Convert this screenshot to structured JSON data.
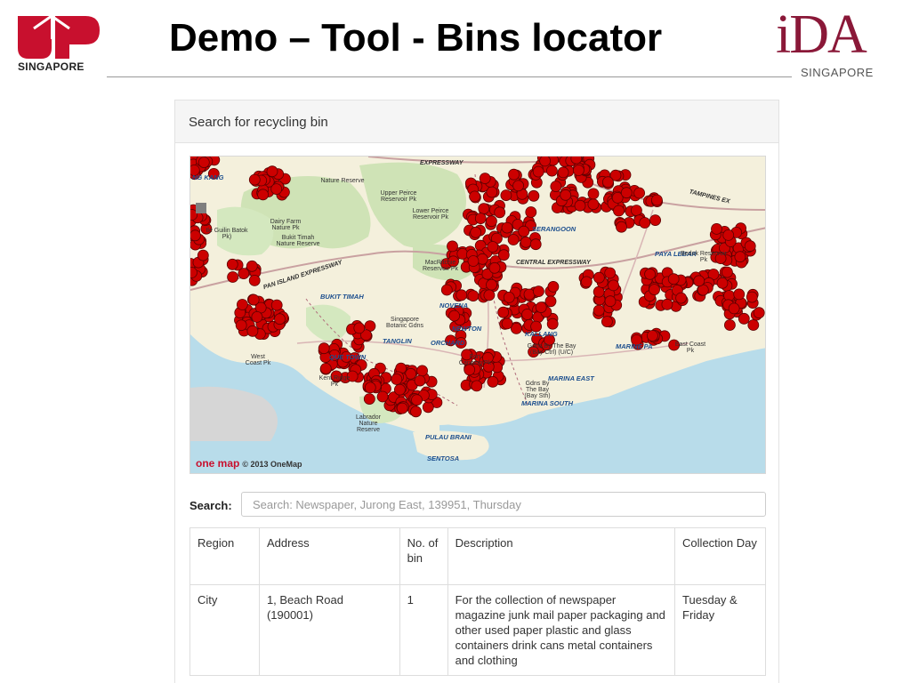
{
  "slide": {
    "title": "Demo – Tool - Bins locator",
    "left_logo_text": "SINGAPORE",
    "right_logo_text": "iDA",
    "right_logo_sub": "SINGAPORE"
  },
  "panel": {
    "heading": "Search for recycling bin"
  },
  "map": {
    "credit": "© 2013 OneMap",
    "credit_logo": "one map",
    "marker_color": "#cc0000",
    "labels": {
      "jurong_kang": "NG KANG",
      "nature_reserve": "Nature Reserve",
      "upper_peirce": "Upper Peirce Reservoir Pk",
      "lower_peirce": "Lower Peirce Reservoir Pk",
      "dairy_farm": "Dairy Farm Nature Pk",
      "bukit_timah_reserve": "Bukit Timah Nature Reserve",
      "guilin": "tle Guilin Batok Pk)",
      "serangoon": "SERANGOON",
      "paya_lebar": "PAYA LEBAR",
      "bedok": "Bedok Reservoir Pk",
      "macritchie": "MacRitchie Reservoir Pk",
      "central_expressway": "CENTRAL EXPRESSWAY",
      "pan_island": "PAN ISLAND EXPRESSWAY",
      "bukit_timah": "BUKIT TIMAH",
      "novena": "NOVENA",
      "singapore_botanic": "Singapore Botanic Gdns",
      "tanglin": "TANGLIN",
      "newton": "NEWTON",
      "orchard": "ORCHARD",
      "kallang": "KALLANG",
      "marine_parade": "MARINE PA",
      "east_coast": "East Coast Pk",
      "west_coast": "West Coast Pk",
      "queenstown": "QUE    TOWN",
      "kent_ridge": "Kent Ridge Pk",
      "fort_canning": "Fort Canning Pk",
      "gdns_bay_ctrl": "Gdns By The Bay (Bay Ctrl) (U/C)",
      "marina_east": "MARINA EAST",
      "gdns_bay_sth": "Gdns By The Bay (Bay Sth)",
      "marina_south": "MARINA SOUTH",
      "labrador": "Labrador Nature Reserve",
      "pulau_brani": "PULAU BRANI",
      "sentosa": "SENTOSA",
      "tampines_exp": "TAMPINES EX",
      "expressway_top": "EXPRESSWAY"
    }
  },
  "search": {
    "label": "Search:",
    "placeholder": "Search: Newspaper, Jurong East, 139951, Thursday"
  },
  "table": {
    "headers": [
      "Region",
      "Address",
      "No. of bin",
      "Description",
      "Collection Day"
    ],
    "rows": [
      {
        "region": "City",
        "address": "1, Beach Road (190001)",
        "bins": "1",
        "description": "For the collection of newspaper magazine junk mail paper packaging and other used paper plastic and glass containers drink cans metal containers and clothing",
        "day": "Tuesday & Friday"
      }
    ]
  }
}
